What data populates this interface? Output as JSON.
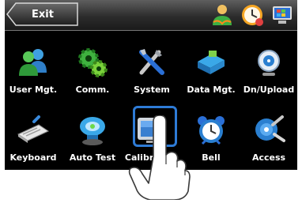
{
  "topbar": {
    "exit_label": "Exit",
    "icons": [
      "user-status-icon",
      "clock-icon",
      "monitor-icon"
    ]
  },
  "menu": {
    "items": [
      {
        "label": "User Mgt.",
        "icon": "users-icon"
      },
      {
        "label": "Comm.",
        "icon": "gears-icon"
      },
      {
        "label": "System",
        "icon": "tools-icon"
      },
      {
        "label": "Data Mgt.",
        "icon": "database-icon"
      },
      {
        "label": "Dn/Upload",
        "icon": "disc-icon"
      },
      {
        "label": "Keyboard",
        "icon": "keyboard-icon"
      },
      {
        "label": "Auto Test",
        "icon": "autotest-icon"
      },
      {
        "label": "Calibration",
        "icon": "calibration-icon"
      },
      {
        "label": "Bell",
        "icon": "alarm-clock-icon"
      },
      {
        "label": "Access",
        "icon": "keys-icon"
      }
    ],
    "selected": "Calibration"
  },
  "colors": {
    "background": "#000000",
    "topbar": "#3a3a3a",
    "accent": "#2e7bd6",
    "label": "#ffffff"
  }
}
